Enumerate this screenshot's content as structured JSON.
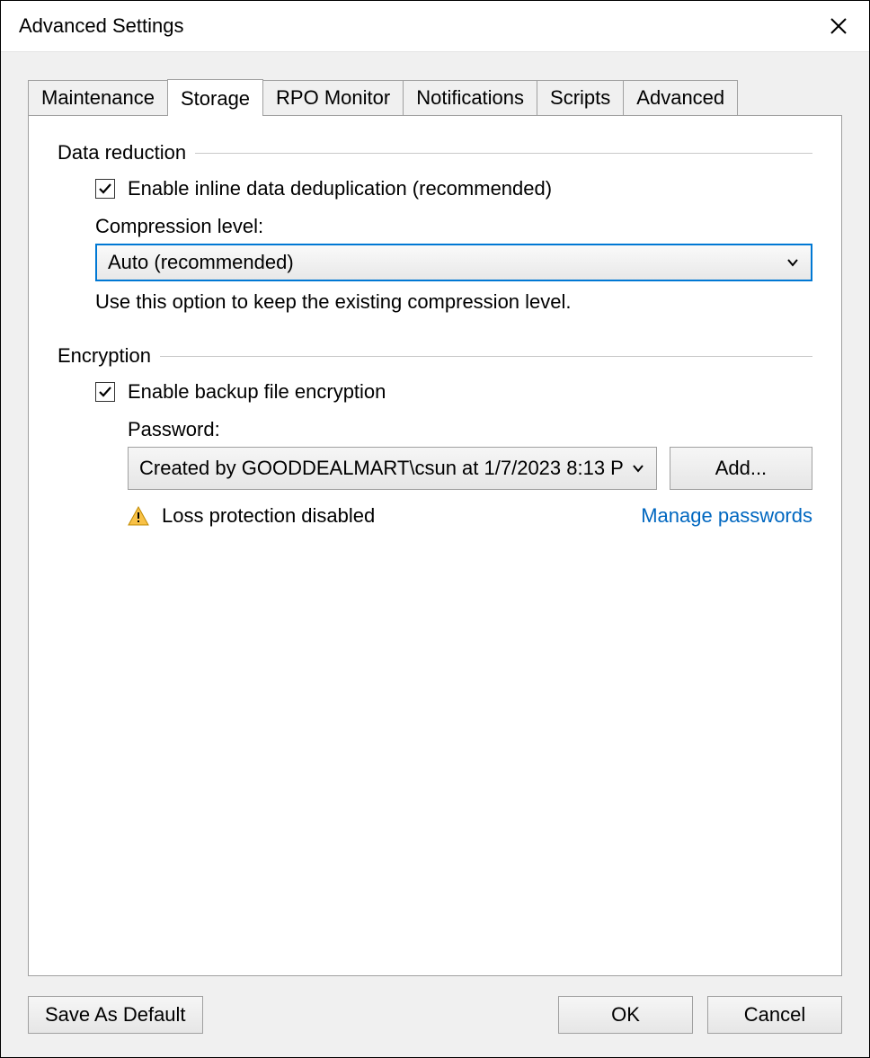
{
  "window": {
    "title": "Advanced Settings"
  },
  "tabs": [
    {
      "label": "Maintenance",
      "active": false
    },
    {
      "label": "Storage",
      "active": true
    },
    {
      "label": "RPO Monitor",
      "active": false
    },
    {
      "label": "Notifications",
      "active": false
    },
    {
      "label": "Scripts",
      "active": false
    },
    {
      "label": "Advanced",
      "active": false
    }
  ],
  "data_reduction": {
    "legend": "Data reduction",
    "dedup_checkbox_label": "Enable inline data deduplication (recommended)",
    "dedup_checked": true,
    "compression_label": "Compression level:",
    "compression_value": "Auto (recommended)",
    "compression_hint": "Use this option to keep the existing compression level."
  },
  "encryption": {
    "legend": "Encryption",
    "checkbox_label": "Enable backup file encryption",
    "checked": true,
    "password_label": "Password:",
    "password_value": "Created by GOODDEALMART\\csun at 1/7/2023 8:13 P",
    "add_button": "Add...",
    "loss_text": "Loss protection disabled",
    "manage_link": "Manage passwords"
  },
  "footer": {
    "save_default": "Save As Default",
    "ok": "OK",
    "cancel": "Cancel"
  }
}
